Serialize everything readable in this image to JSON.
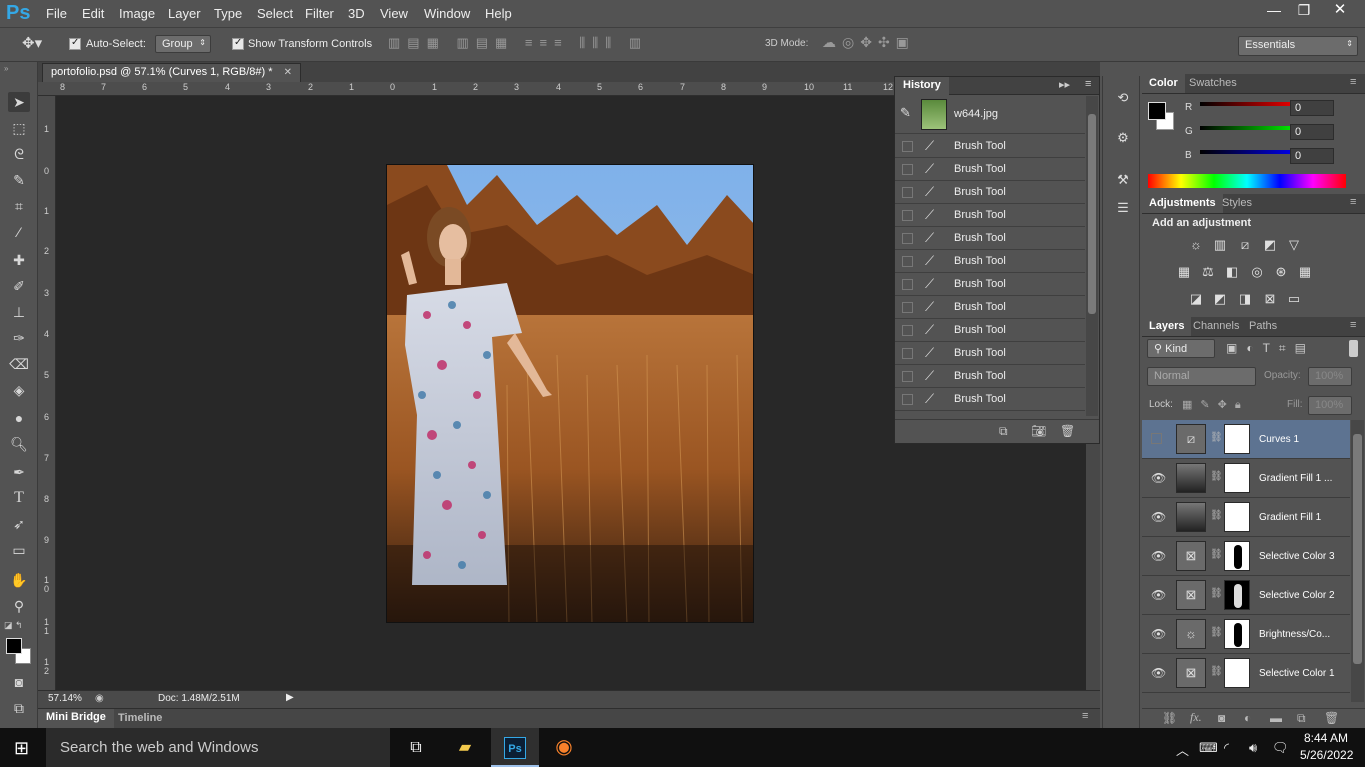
{
  "app": {
    "logo": "Ps"
  },
  "menu": [
    "File",
    "Edit",
    "Image",
    "Layer",
    "Type",
    "Select",
    "Filter",
    "3D",
    "View",
    "Window",
    "Help"
  ],
  "window_controls": {
    "minimize": "—",
    "restore": "❐",
    "close": "✕"
  },
  "options_bar": {
    "auto_select_label": "Auto-Select:",
    "auto_select_value": "Group",
    "show_transform_label": "Show Transform Controls",
    "mode_3d_label": "3D Mode:",
    "workspace": "Essentials"
  },
  "document": {
    "tab_title": "portofolio.psd @ 57.1% (Curves 1, RGB/8#) *",
    "close": "✕",
    "zoom": "57.14%",
    "doc_info": "Doc: 1.48M/2.51M"
  },
  "ruler_h": [
    "8",
    "7",
    "6",
    "5",
    "4",
    "3",
    "2",
    "1",
    "0",
    "1",
    "2",
    "3",
    "4",
    "5",
    "6",
    "7",
    "8",
    "9",
    "10",
    "11",
    "12"
  ],
  "ruler_v": [
    "1",
    "0",
    "1",
    "2",
    "3",
    "4",
    "5",
    "6",
    "7",
    "8",
    "9",
    "1 0",
    "1 1",
    "1 2"
  ],
  "bottom_tabs": [
    "Mini Bridge",
    "Timeline"
  ],
  "history": {
    "title": "History",
    "snapshot": "w644.jpg",
    "items": [
      "Brush Tool",
      "Brush Tool",
      "Brush Tool",
      "Brush Tool",
      "Brush Tool",
      "Brush Tool",
      "Brush Tool",
      "Brush Tool",
      "Brush Tool",
      "Brush Tool",
      "Brush Tool",
      "Brush Tool"
    ]
  },
  "color_panel": {
    "tabs": [
      "Color",
      "Swatches"
    ],
    "r_label": "R",
    "g_label": "G",
    "b_label": "B",
    "r": "0",
    "g": "0",
    "b": "0"
  },
  "adjustments_panel": {
    "tabs": [
      "Adjustments",
      "Styles"
    ],
    "heading": "Add an adjustment"
  },
  "layers_panel": {
    "tabs": [
      "Layers",
      "Channels",
      "Paths"
    ],
    "kind": "Kind",
    "blend_mode": "Normal",
    "opacity_label": "Opacity:",
    "opacity": "100%",
    "lock_label": "Lock:",
    "fill_label": "Fill:",
    "fill": "100%",
    "fx": "fx.",
    "layers": [
      {
        "name": "Curves 1",
        "icon": "curves-icon",
        "selected": true,
        "visible": false
      },
      {
        "name": "Gradient Fill 1 ...",
        "icon": "gradient-icon",
        "selected": false,
        "visible": true
      },
      {
        "name": "Gradient Fill 1",
        "icon": "gradient-icon",
        "selected": false,
        "visible": true
      },
      {
        "name": "Selective Color 3",
        "icon": "selective-color-icon",
        "selected": false,
        "visible": true
      },
      {
        "name": "Selective Color 2",
        "icon": "selective-color-icon",
        "selected": false,
        "visible": true
      },
      {
        "name": "Brightness/Co...",
        "icon": "brightness-icon",
        "selected": false,
        "visible": true
      },
      {
        "name": "Selective Color 1",
        "icon": "selective-color-icon",
        "selected": false,
        "visible": true
      }
    ]
  },
  "taskbar": {
    "search_placeholder": "Search the web and Windows",
    "time": "8:44 AM",
    "date": "5/26/2022"
  },
  "colors": {
    "accent": "#34a8e6",
    "panel": "#535353",
    "canvas": "#282828",
    "selected_layer": "#5d7391"
  }
}
